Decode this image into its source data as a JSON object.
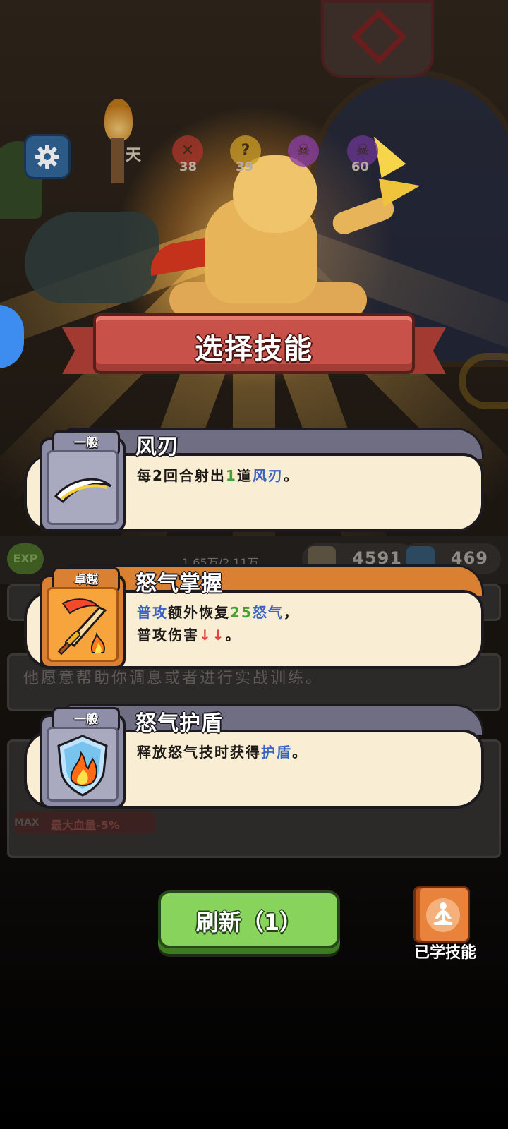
{
  "top_bar": {
    "day_label": "天",
    "stats": [
      {
        "icon": "crossed-swords-icon",
        "value": "38"
      },
      {
        "icon": "question-mark-icon",
        "value": "39",
        "glyph": "?"
      },
      {
        "icon": "skull-icon",
        "value": ""
      },
      {
        "icon": "skull-icon",
        "value": "60"
      }
    ]
  },
  "title": "选择技能",
  "hud": {
    "exp_label": "EXP",
    "hp_text": "1.65万/2.11万",
    "attack_value": "4591",
    "defense_value": "469"
  },
  "dim_panel": {
    "npc_text": "他愿意帮助你调息或者进行实战训练。",
    "max_label": "MAX",
    "stat_text": "最大血量-5%"
  },
  "skills": [
    {
      "rarity": "一般",
      "name": "风刃",
      "desc_parts": [
        {
          "text": "每2回合射出",
          "style": "normal"
        },
        {
          "text": "1",
          "style": "green"
        },
        {
          "text": "道",
          "style": "normal"
        },
        {
          "text": "风刃",
          "style": "blue"
        },
        {
          "text": "。",
          "style": "normal"
        }
      ]
    },
    {
      "rarity": "卓越",
      "name": "怒气掌握",
      "desc_line1": [
        {
          "text": "普攻",
          "style": "blue"
        },
        {
          "text": "额外恢复",
          "style": "normal"
        },
        {
          "text": "25",
          "style": "green"
        },
        {
          "text": "怒气",
          "style": "blue"
        },
        {
          "text": "，",
          "style": "normal"
        }
      ],
      "desc_line2": [
        {
          "text": "普攻伤害",
          "style": "normal"
        },
        {
          "text": "↓↓",
          "style": "red"
        },
        {
          "text": "。",
          "style": "normal"
        }
      ]
    },
    {
      "rarity": "一般",
      "name": "怒气护盾",
      "desc_parts": [
        {
          "text": "释放怒气技时获得",
          "style": "normal"
        },
        {
          "text": "护盾",
          "style": "blue"
        },
        {
          "text": "。",
          "style": "normal"
        }
      ]
    }
  ],
  "refresh_button": {
    "label": "刷新（1）"
  },
  "learned_skills_button": {
    "label": "已学技能"
  },
  "colors": {
    "normal_rarity": "#8e8ea8",
    "epic_rarity": "#d98033",
    "highlight_blue": "#3a63c4",
    "highlight_green": "#47a032",
    "highlight_red": "#e2453b",
    "refresh_green": "#88d35c",
    "ribbon_red": "#c8524a"
  }
}
